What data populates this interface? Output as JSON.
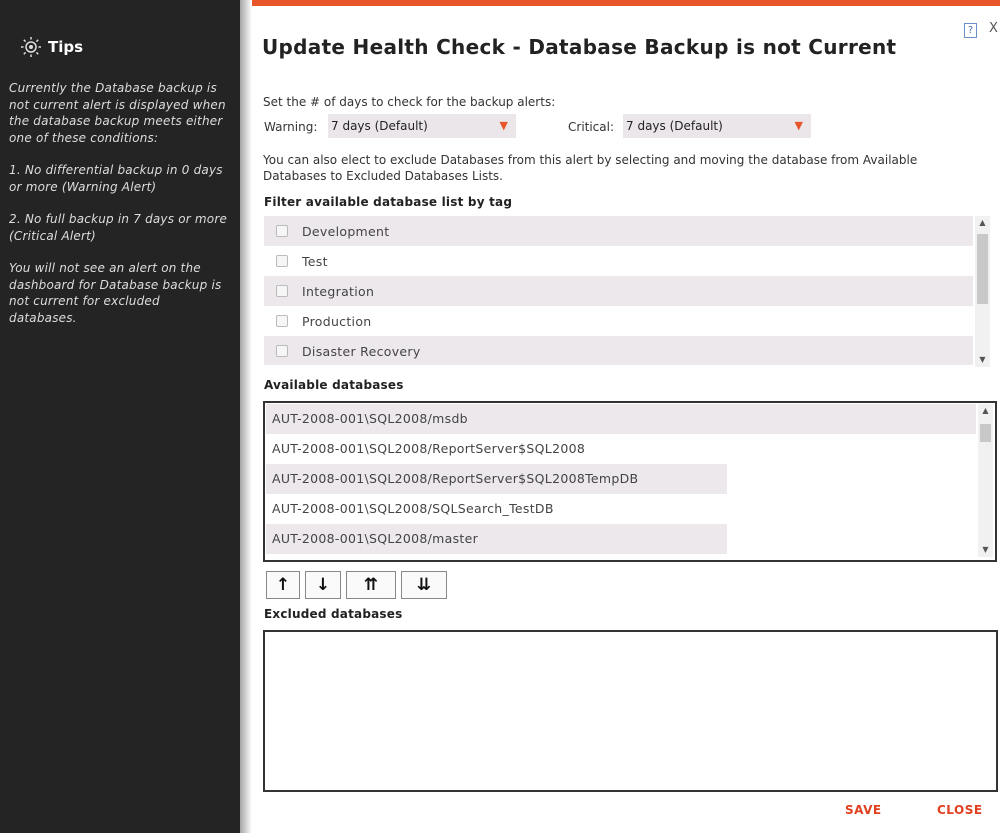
{
  "sidebar": {
    "title": "Tips",
    "paragraphs": [
      "Currently the Database backup is not current alert is displayed when the database backup meets either one of these conditions:",
      "1. No differential backup in 0 days or more (Warning Alert)",
      "2. No full backup in 7 days or more (Critical Alert)",
      "You will not see an alert on the dashboard for Database backup is not current for excluded databases."
    ]
  },
  "dialog": {
    "title": "Update Health Check - Database Backup is not Current",
    "help_label": "?",
    "close_x_label": "X",
    "days_prompt": "Set the # of days to check for the backup alerts:",
    "warning_label": "Warning:",
    "warning_value": "7 days (Default)",
    "critical_label": "Critical:",
    "critical_value": "7 days (Default)",
    "exclude_line1": "You can also elect to exclude Databases from this alert by selecting and moving the database from Available",
    "exclude_line2": "Databases to Excluded Databases Lists.",
    "filter_heading": "Filter available database list by tag",
    "tags": [
      "Development",
      "Test",
      "Integration",
      "Production",
      "Disaster Recovery"
    ],
    "available_heading": "Available databases",
    "available_databases": [
      "AUT-2008-001\\SQL2008/msdb",
      "AUT-2008-001\\SQL2008/ReportServer$SQL2008",
      "AUT-2008-001\\SQL2008/ReportServer$SQL2008TempDB",
      "AUT-2008-001\\SQL2008/SQLSearch_TestDB",
      "AUT-2008-001\\SQL2008/master"
    ],
    "move_buttons": [
      "↑",
      "↓",
      "⇈",
      "⇊"
    ],
    "excluded_heading": "Excluded databases",
    "save_label": "SAVE",
    "close_label": "CLOSE"
  },
  "colors": {
    "accent": "#e8552a",
    "sidebar_bg": "#242424",
    "row_alt": "#ede8ec"
  }
}
